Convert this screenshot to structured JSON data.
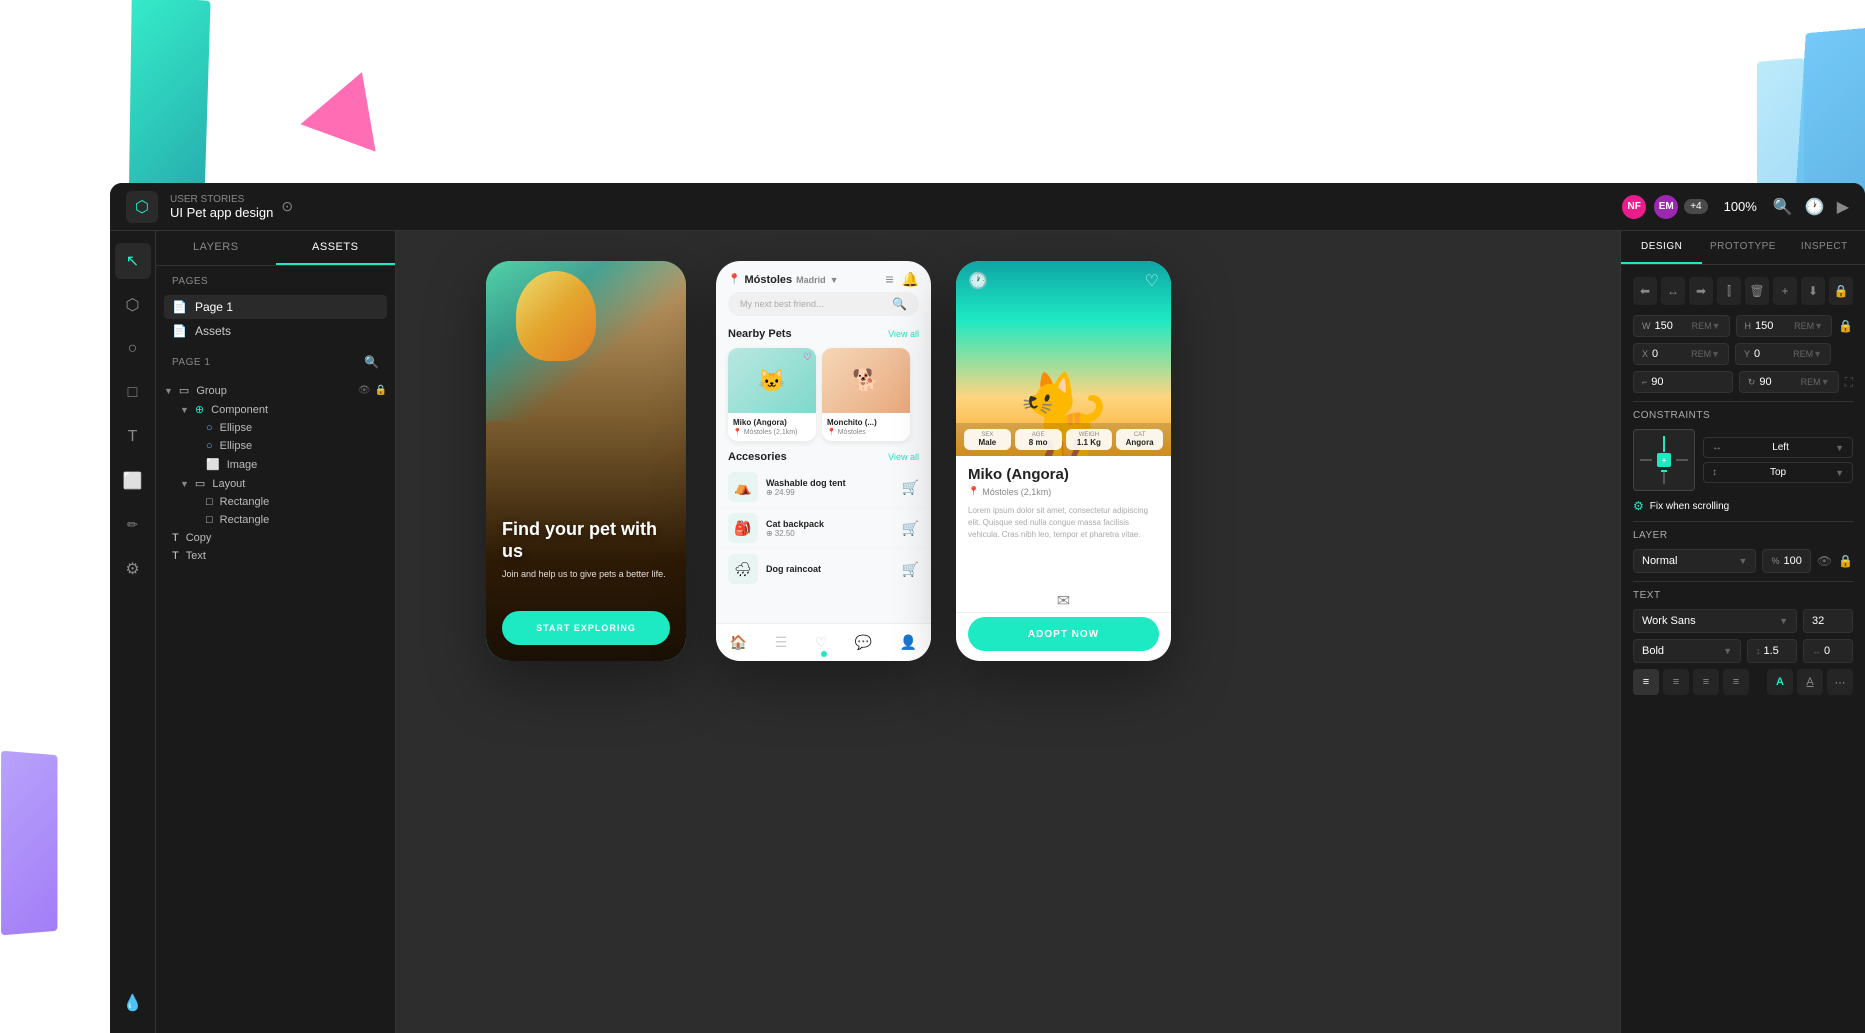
{
  "app": {
    "title": "UI Pet app design",
    "subtitle": "USER STORIES",
    "logo_icon": "figma-icon",
    "zoom": "100%",
    "avatars": [
      {
        "initials": "NF",
        "color": "#e91e8c"
      },
      {
        "initials": "EM",
        "color": "#9c27b0"
      },
      {
        "badge": "+4"
      }
    ]
  },
  "top_bar": {
    "chevron_label": "⊙",
    "search_icon": "🔍",
    "history_icon": "🕐",
    "play_icon": "▶"
  },
  "left_sidebar": {
    "tools": [
      {
        "name": "select",
        "icon": "↖",
        "active": true
      },
      {
        "name": "frame",
        "icon": "⬡"
      },
      {
        "name": "component",
        "icon": "○"
      },
      {
        "name": "rectangle",
        "icon": "□"
      },
      {
        "name": "text",
        "icon": "T"
      },
      {
        "name": "image",
        "icon": "⬜"
      },
      {
        "name": "pen",
        "icon": "✏"
      },
      {
        "name": "plugin",
        "icon": "⚙"
      },
      {
        "name": "drip",
        "icon": "💧"
      }
    ]
  },
  "layers_panel": {
    "tabs": [
      {
        "label": "LAYERS",
        "active": false
      },
      {
        "label": "ASSETS",
        "active": true
      }
    ],
    "pages_label": "PAGES",
    "pages": [
      {
        "name": "Page 1",
        "icon": "📄",
        "active": true
      },
      {
        "name": "Assets",
        "icon": "📄",
        "active": false
      }
    ],
    "page1_label": "PAGE 1",
    "layers": [
      {
        "name": "Group",
        "indent": 0,
        "type": "frame",
        "icon": "▷",
        "expanded": true,
        "has_eye": true,
        "has_lock": true
      },
      {
        "name": "Component",
        "indent": 1,
        "type": "component",
        "icon": "⊕",
        "expanded": true
      },
      {
        "name": "Ellipse",
        "indent": 2,
        "type": "ellipse",
        "icon": "○"
      },
      {
        "name": "Ellipse",
        "indent": 2,
        "type": "ellipse",
        "icon": "○"
      },
      {
        "name": "Image",
        "indent": 2,
        "type": "image",
        "icon": "⬜"
      },
      {
        "name": "Layout",
        "indent": 1,
        "type": "layout",
        "icon": "▷",
        "expanded": true
      },
      {
        "name": "Rectangle",
        "indent": 2,
        "type": "rect",
        "icon": "□"
      },
      {
        "name": "Rectangle",
        "indent": 2,
        "type": "rect",
        "icon": "□"
      },
      {
        "name": "Copy",
        "indent": 0,
        "type": "text",
        "icon": "T"
      },
      {
        "name": "Text",
        "indent": 0,
        "type": "text",
        "icon": "T"
      }
    ]
  },
  "canvas": {
    "phone1": {
      "headline": "Find your pet with us",
      "subtext": "Join and help us to give pets a better life.",
      "cta": "START EXPLORING"
    },
    "phone2": {
      "location": "Móstoles",
      "location_sub": "Madrid",
      "search_placeholder": "My next best friend...",
      "section1": "Nearby Pets",
      "view_all1": "View all",
      "section2": "Accesories",
      "view_all2": "View all",
      "pets": [
        {
          "name": "Miko (Angora)",
          "location": "Móstoles (2,1km)"
        },
        {
          "name": "Monchito (...)",
          "location": "Móstoles"
        }
      ],
      "accessories": [
        {
          "name": "Washable dog tent",
          "price": "24.99"
        },
        {
          "name": "Cat backpack",
          "price": "32.50"
        },
        {
          "name": "Dog raincoat",
          "price": "..."
        }
      ]
    },
    "phone3": {
      "pet_name": "Miko (Angora)",
      "location": "Móstoles (2,1km)",
      "stats": [
        {
          "label": "Sex",
          "value": "Male"
        },
        {
          "label": "Age",
          "value": "8 mo"
        },
        {
          "label": "Weigh",
          "value": "1.1 Kg"
        },
        {
          "label": "Cat",
          "value": "Angora"
        }
      ],
      "description": "Lorem ipsum dolor sit amet, consectetur adipiscing elit. Quisque sed nulla congue massa facilisis vehicula. Cras nibh leo, tempor et pharetra vitae.",
      "adopt_btn": "ADOPT NOW"
    }
  },
  "right_panel": {
    "tabs": [
      {
        "label": "DESIGN",
        "active": true
      },
      {
        "label": "PROTOTYPE",
        "active": false
      },
      {
        "label": "INSPECT",
        "active": false
      }
    ],
    "dimensions": {
      "w_label": "W",
      "w_value": "150",
      "w_unit": "REM",
      "h_label": "H",
      "h_value": "150",
      "h_unit": "REM",
      "x_label": "X",
      "x_value": "0",
      "x_unit": "REM",
      "y_label": "Y",
      "y_value": "0",
      "y_unit": "REM",
      "corner_label": "L",
      "corner_value": "90",
      "rotation_value": "90",
      "rotation_unit": "REM"
    },
    "constraints": {
      "title": "CONSTRAINTS",
      "horizontal": "Left",
      "vertical": "Top",
      "fix_scrolling": "Fix when scrolling"
    },
    "layer": {
      "title": "LAYER",
      "mode": "Normal",
      "opacity": "100"
    },
    "text": {
      "title": "TEXT",
      "font": "Work Sans",
      "size": "32",
      "style": "Bold",
      "line_height": "1.5",
      "letter_spacing": "0",
      "align_icons": [
        "align-left",
        "align-center",
        "align-right",
        "align-justify"
      ],
      "color_icon": "A",
      "stroke_icon": "A",
      "more_icon": "..."
    }
  }
}
